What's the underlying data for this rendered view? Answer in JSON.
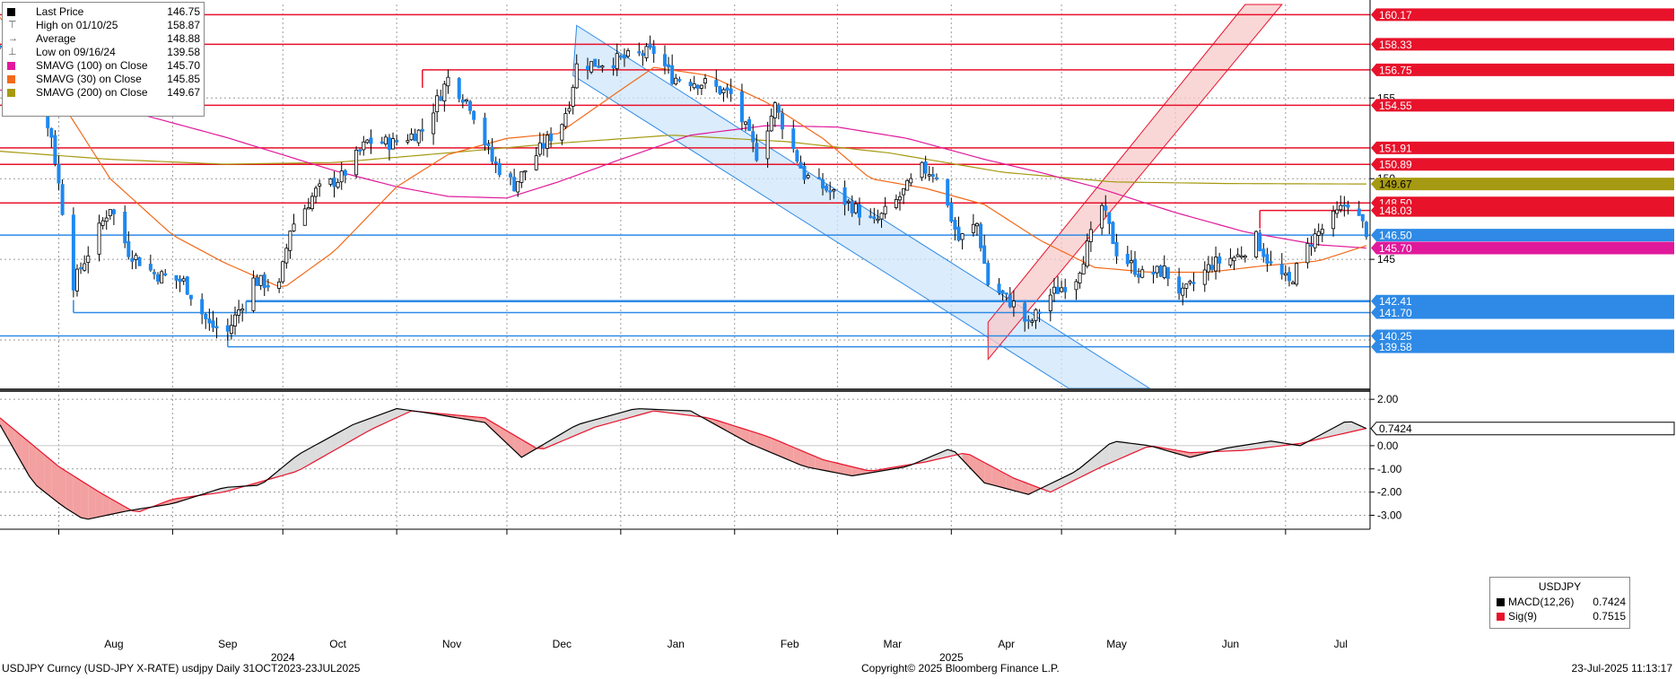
{
  "legend": {
    "items": [
      {
        "label": "Last Price",
        "value": "146.75",
        "color": "#000000",
        "glyph": "■"
      },
      {
        "label": "High on 01/10/25",
        "value": "158.87",
        "color": "#777777",
        "glyph": "⊤"
      },
      {
        "label": "Average",
        "value": "148.88",
        "color": "#777777",
        "glyph": "→"
      },
      {
        "label": "Low on 09/16/24",
        "value": "139.58",
        "color": "#777777",
        "glyph": "⊥"
      },
      {
        "label": "SMAVG (100)  on Close",
        "value": "145.70",
        "color": "#e0199b",
        "glyph": ""
      },
      {
        "label": "SMAVG (30)  on Close",
        "value": "145.85",
        "color": "#f26a1b",
        "glyph": ""
      },
      {
        "label": "SMAVG (200)  on Close",
        "value": "149.67",
        "color": "#a69a12",
        "glyph": ""
      }
    ]
  },
  "price_axis_ticks": [
    "155",
    "150",
    "145"
  ],
  "price_tags": [
    {
      "value": 160.17,
      "label": "160.17",
      "color": "#e8122b"
    },
    {
      "value": 158.33,
      "label": "158.33",
      "color": "#e8122b"
    },
    {
      "value": 156.75,
      "label": "156.75",
      "color": "#e8122b"
    },
    {
      "value": 154.55,
      "label": "154.55",
      "color": "#e8122b"
    },
    {
      "value": 151.91,
      "label": "151.91",
      "color": "#e8122b"
    },
    {
      "value": 150.89,
      "label": "150.89",
      "color": "#e8122b"
    },
    {
      "value": 149.67,
      "label": "149.67",
      "color": "#a69a12"
    },
    {
      "value": 148.5,
      "label": "148.50",
      "color": "#e8122b"
    },
    {
      "value": 148.03,
      "label": "148.03",
      "color": "#e8122b"
    },
    {
      "value": 146.5,
      "label": "146.50",
      "color": "#2e8ae6"
    },
    {
      "value": 145.7,
      "label": "145.70",
      "color": "#e0199b"
    },
    {
      "value": 142.41,
      "label": "142.41",
      "color": "#2e8ae6"
    },
    {
      "value": 141.7,
      "label": "141.70",
      "color": "#2e8ae6"
    },
    {
      "value": 140.25,
      "label": "140.25",
      "color": "#2e8ae6"
    },
    {
      "value": 139.58,
      "label": "139.58",
      "color": "#2e8ae6"
    }
  ],
  "macd_axis_ticks": [
    "2.00",
    "0.00",
    "-1.00",
    "-2.00",
    "-3.00"
  ],
  "macd_tag": {
    "label": "0.7424",
    "color": "#000000"
  },
  "macd_legend": {
    "title": "USDJPY",
    "items": [
      {
        "label": "MACD(12,26)",
        "value": "0.7424",
        "color": "#000000"
      },
      {
        "label": "Sig(9)",
        "value": "0.7515",
        "color": "#e8122b"
      }
    ]
  },
  "x_axis": {
    "months": [
      "Aug",
      "Sep",
      "Oct",
      "Nov",
      "Dec",
      "Jan",
      "Feb",
      "Mar",
      "Apr",
      "May",
      "Jun",
      "Jul"
    ],
    "years": [
      "2024",
      "2025"
    ]
  },
  "footer": {
    "left": "USDJPY Curncy (USD-JPY X-RATE) usdjpy  Daily 31OCT2023-23JUL2025",
    "center": "Copyright© 2025 Bloomberg Finance L.P.",
    "right": "23-Jul-2025 11:13:17"
  },
  "colors": {
    "up": "#ffffff",
    "down": "#1e88f0",
    "red_line": "#e8122b",
    "blue_line": "#2e8ae6",
    "sma100": "#e0199b",
    "sma30": "#f26a1b",
    "sma200": "#a69a12",
    "channel_blue": "#cfe6fb",
    "channel_red": "#f8c9c9"
  },
  "chart_data": {
    "type": "candlestick",
    "symbol": "USDJPY",
    "period": "Daily",
    "ylim": [
      137.0,
      160.8
    ],
    "macd_ylim": [
      -3.6,
      2.2
    ],
    "x_start": "2024-07-16",
    "horizontal_levels": {
      "resistance": [
        160.17,
        158.33,
        156.75,
        154.55,
        151.91,
        150.89,
        148.5,
        148.03
      ],
      "support": [
        146.5,
        142.41,
        141.7,
        140.25,
        139.58
      ]
    },
    "close_anchors": [
      [
        "2024-07-16",
        158.2
      ],
      [
        "2024-07-23",
        155.6
      ],
      [
        "2024-07-30",
        152.7
      ],
      [
        "2024-08-05",
        143.5
      ],
      [
        "2024-08-15",
        148.3
      ],
      [
        "2024-08-20",
        145.5
      ],
      [
        "2024-08-27",
        144.1
      ],
      [
        "2024-09-04",
        143.6
      ],
      [
        "2024-09-11",
        140.9
      ],
      [
        "2024-09-16",
        140.5
      ],
      [
        "2024-09-23",
        143.7
      ],
      [
        "2024-09-30",
        143.3
      ],
      [
        "2024-10-03",
        146.9
      ],
      [
        "2024-10-10",
        149.2
      ],
      [
        "2024-10-17",
        150.1
      ],
      [
        "2024-10-24",
        152.3
      ],
      [
        "2024-10-31",
        152.2
      ],
      [
        "2024-11-08",
        153.0
      ],
      [
        "2024-11-15",
        156.2
      ],
      [
        "2024-11-21",
        154.6
      ],
      [
        "2024-11-27",
        151.1
      ],
      [
        "2024-12-03",
        149.6
      ],
      [
        "2024-12-10",
        151.8
      ],
      [
        "2024-12-16",
        153.5
      ],
      [
        "2024-12-18",
        154.8
      ],
      [
        "2024-12-20",
        157.0
      ],
      [
        "2024-12-30",
        157.3
      ],
      [
        "2025-01-10",
        157.9
      ],
      [
        "2025-01-15",
        156.3
      ],
      [
        "2025-01-24",
        155.9
      ],
      [
        "2025-01-31",
        155.2
      ],
      [
        "2025-02-07",
        151.5
      ],
      [
        "2025-02-12",
        154.5
      ],
      [
        "2025-02-20",
        150.2
      ],
      [
        "2025-02-27",
        149.2
      ],
      [
        "2025-03-05",
        148.3
      ],
      [
        "2025-03-11",
        147.2
      ],
      [
        "2025-03-17",
        148.6
      ],
      [
        "2025-03-24",
        150.6
      ],
      [
        "2025-03-28",
        150.3
      ],
      [
        "2025-04-03",
        146.2
      ],
      [
        "2025-04-08",
        147.2
      ],
      [
        "2025-04-11",
        143.5
      ],
      [
        "2025-04-18",
        142.2
      ],
      [
        "2025-04-22",
        140.9
      ],
      [
        "2025-04-28",
        142.8
      ],
      [
        "2025-05-05",
        143.9
      ],
      [
        "2025-05-12",
        148.3
      ],
      [
        "2025-05-16",
        145.5
      ],
      [
        "2025-05-23",
        144.0
      ],
      [
        "2025-05-29",
        144.3
      ],
      [
        "2025-06-03",
        142.8
      ],
      [
        "2025-06-11",
        144.7
      ],
      [
        "2025-06-18",
        145.2
      ],
      [
        "2025-06-23",
        146.3
      ],
      [
        "2025-06-27",
        144.6
      ],
      [
        "2025-07-02",
        143.5
      ],
      [
        "2025-07-08",
        146.2
      ],
      [
        "2025-07-15",
        147.8
      ],
      [
        "2025-07-18",
        148.6
      ],
      [
        "2025-07-23",
        146.75
      ]
    ],
    "macd_anchors": [
      [
        "2024-07-16",
        0.9
      ],
      [
        "2024-07-25",
        -1.6
      ],
      [
        "2024-08-02",
        -2.6
      ],
      [
        "2024-08-08",
        -3.2
      ],
      [
        "2024-08-20",
        -2.8
      ],
      [
        "2024-09-01",
        -2.5
      ],
      [
        "2024-09-15",
        -1.8
      ],
      [
        "2024-09-25",
        -1.7
      ],
      [
        "2024-10-05",
        -0.4
      ],
      [
        "2024-10-20",
        0.9
      ],
      [
        "2024-11-01",
        1.6
      ],
      [
        "2024-11-10",
        1.4
      ],
      [
        "2024-11-25",
        1.0
      ],
      [
        "2024-12-05",
        -0.5
      ],
      [
        "2024-12-20",
        0.9
      ],
      [
        "2025-01-05",
        1.6
      ],
      [
        "2025-01-20",
        1.5
      ],
      [
        "2025-02-05",
        0.1
      ],
      [
        "2025-02-20",
        -0.9
      ],
      [
        "2025-03-05",
        -1.3
      ],
      [
        "2025-03-20",
        -0.9
      ],
      [
        "2025-04-01",
        -0.1
      ],
      [
        "2025-04-10",
        -1.6
      ],
      [
        "2025-04-22",
        -2.1
      ],
      [
        "2025-05-05",
        -1.1
      ],
      [
        "2025-05-15",
        0.2
      ],
      [
        "2025-05-25",
        0.0
      ],
      [
        "2025-06-05",
        -0.5
      ],
      [
        "2025-06-15",
        -0.1
      ],
      [
        "2025-06-27",
        0.2
      ],
      [
        "2025-07-05",
        0.0
      ],
      [
        "2025-07-18",
        1.1
      ],
      [
        "2025-07-23",
        0.74
      ]
    ],
    "signal_anchors": [
      [
        "2024-07-16",
        1.2
      ],
      [
        "2024-08-01",
        -0.9
      ],
      [
        "2024-08-12",
        -2.0
      ],
      [
        "2024-08-22",
        -2.9
      ],
      [
        "2024-09-01",
        -2.3
      ],
      [
        "2024-09-15",
        -2.0
      ],
      [
        "2024-10-05",
        -1.1
      ],
      [
        "2024-10-25",
        0.7
      ],
      [
        "2024-11-05",
        1.5
      ],
      [
        "2024-11-25",
        1.2
      ],
      [
        "2024-12-10",
        -0.2
      ],
      [
        "2024-12-25",
        0.8
      ],
      [
        "2025-01-10",
        1.5
      ],
      [
        "2025-01-25",
        1.2
      ],
      [
        "2025-02-10",
        0.4
      ],
      [
        "2025-02-25",
        -0.6
      ],
      [
        "2025-03-10",
        -1.1
      ],
      [
        "2025-03-25",
        -0.7
      ],
      [
        "2025-04-05",
        -0.3
      ],
      [
        "2025-04-18",
        -1.4
      ],
      [
        "2025-04-28",
        -2.0
      ],
      [
        "2025-05-12",
        -0.9
      ],
      [
        "2025-05-25",
        0.0
      ],
      [
        "2025-06-05",
        -0.3
      ],
      [
        "2025-06-20",
        -0.2
      ],
      [
        "2025-07-05",
        0.1
      ],
      [
        "2025-07-23",
        0.75
      ]
    ],
    "sma30_anchors": [
      [
        "2024-07-16",
        160.0
      ],
      [
        "2024-08-01",
        155.0
      ],
      [
        "2024-08-15",
        150.0
      ],
      [
        "2024-09-01",
        146.5
      ],
      [
        "2024-09-15",
        144.8
      ],
      [
        "2024-10-01",
        143.2
      ],
      [
        "2024-10-15",
        145.5
      ],
      [
        "2024-11-01",
        149.5
      ],
      [
        "2024-11-15",
        151.5
      ],
      [
        "2024-12-01",
        152.5
      ],
      [
        "2024-12-15",
        152.8
      ],
      [
        "2025-01-01",
        155.5
      ],
      [
        "2025-01-10",
        156.9
      ],
      [
        "2025-01-25",
        156.4
      ],
      [
        "2025-02-10",
        154.7
      ],
      [
        "2025-02-25",
        152.5
      ],
      [
        "2025-03-10",
        150.0
      ],
      [
        "2025-03-25",
        149.4
      ],
      [
        "2025-04-10",
        148.4
      ],
      [
        "2025-04-25",
        146.2
      ],
      [
        "2025-05-10",
        144.5
      ],
      [
        "2025-05-25",
        144.2
      ],
      [
        "2025-06-10",
        144.2
      ],
      [
        "2025-06-25",
        144.6
      ],
      [
        "2025-07-10",
        144.9
      ],
      [
        "2025-07-23",
        145.85
      ]
    ],
    "sma100_anchors": [
      [
        "2024-07-16",
        155.5
      ],
      [
        "2024-08-15",
        154.5
      ],
      [
        "2024-09-15",
        152.6
      ],
      [
        "2024-10-15",
        150.5
      ],
      [
        "2024-11-01",
        149.5
      ],
      [
        "2024-11-15",
        148.9
      ],
      [
        "2024-12-01",
        148.8
      ],
      [
        "2024-12-15",
        149.8
      ],
      [
        "2025-01-01",
        151.2
      ],
      [
        "2025-01-20",
        152.7
      ],
      [
        "2025-02-10",
        153.3
      ],
      [
        "2025-03-01",
        153.2
      ],
      [
        "2025-03-20",
        152.5
      ],
      [
        "2025-04-10",
        151.2
      ],
      [
        "2025-04-25",
        150.4
      ],
      [
        "2025-05-10",
        149.5
      ],
      [
        "2025-06-01",
        147.9
      ],
      [
        "2025-06-20",
        146.7
      ],
      [
        "2025-07-10",
        145.9
      ],
      [
        "2025-07-23",
        145.7
      ]
    ],
    "sma200_anchors": [
      [
        "2024-07-16",
        151.7
      ],
      [
        "2024-08-15",
        151.2
      ],
      [
        "2024-09-15",
        150.9
      ],
      [
        "2024-10-15",
        151.0
      ],
      [
        "2024-11-15",
        151.6
      ],
      [
        "2024-12-15",
        152.2
      ],
      [
        "2025-01-15",
        152.7
      ],
      [
        "2025-02-15",
        152.3
      ],
      [
        "2025-03-15",
        151.6
      ],
      [
        "2025-04-15",
        150.4
      ],
      [
        "2025-05-15",
        149.8
      ],
      [
        "2025-06-15",
        149.7
      ],
      [
        "2025-07-23",
        149.67
      ]
    ],
    "channels": [
      {
        "name": "descending",
        "upper_start": [
          "2024-12-20",
          159.5
        ],
        "upper_end": [
          "2025-05-25",
          137.0
        ],
        "lower_start": [
          "2024-12-19",
          156.4
        ],
        "lower_end": [
          "2025-05-03",
          137.0
        ]
      },
      {
        "name": "ascending",
        "lower_start": [
          "2025-04-11",
          138.8
        ],
        "lower_end": [
          "2025-06-30",
          160.8
        ],
        "upper_start": [
          "2025-04-11",
          141.1
        ],
        "upper_end": [
          "2025-06-20",
          160.8
        ]
      }
    ]
  }
}
